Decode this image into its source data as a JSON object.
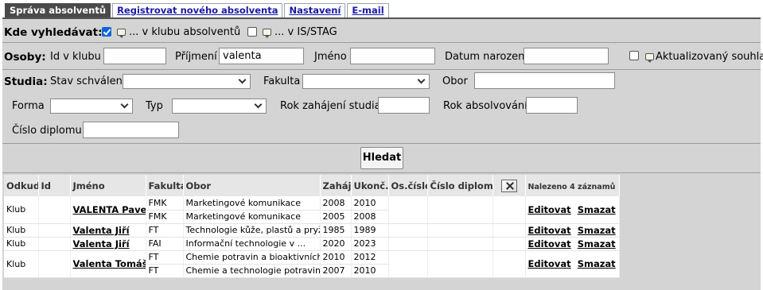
{
  "tabs": [
    {
      "label": "Správa absolventů",
      "active": true
    },
    {
      "label": "Registrovat nového absolventa",
      "active": false
    },
    {
      "label": "Nastavení",
      "active": false
    },
    {
      "label": "E-mail",
      "active": false
    }
  ],
  "search_where": {
    "label": "Kde vyhledávat:",
    "option_club": "... v klubu absolventů",
    "option_club_checked": true,
    "option_stag": "... v IS/STAG",
    "option_stag_checked": false
  },
  "persons": {
    "label": "Osoby:",
    "id_label": "Id v klubu",
    "id_value": "",
    "surname_label": "Příjmení",
    "surname_value": "valenta",
    "name_label": "Jméno",
    "name_value": "",
    "birth_label": "Datum narození",
    "birth_value": "",
    "consent_label": "Aktualizovaný souhlas",
    "consent_checked": false
  },
  "studies": {
    "label": "Studia:",
    "approval_label": "Stav schválení",
    "approval_value": "",
    "faculty_label": "Fakulta",
    "faculty_value": "",
    "field_label": "Obor",
    "field_value": "",
    "form_label": "Forma",
    "form_value": "",
    "type_label": "Typ",
    "type_value": "",
    "start_label": "Rok zahájení studia",
    "start_value": "",
    "end_label": "Rok absolvování",
    "end_value": "",
    "diploma_label": "Číslo diplomu",
    "diploma_value": ""
  },
  "search_button": "Hledat",
  "results": {
    "headers": {
      "source": "Odkud",
      "id": "Id",
      "name": "Jméno",
      "faculty": "Fakulta",
      "field": "Obor",
      "start": "Zaháj.",
      "end": "Ukonč.",
      "personal_no": "Os.číslo",
      "diploma": "Číslo diplomu",
      "found": "Nalezeno 4 záznamů"
    },
    "edit_label": "Editovat",
    "delete_label": "Smazat",
    "rows": [
      {
        "source": "Klub",
        "name": "VALENTA Pavel",
        "studies": [
          {
            "faculty": "FMK",
            "field": "Marketingové komunikace",
            "start": "2008",
            "end": "2010"
          },
          {
            "faculty": "FMK",
            "field": "Marketingové komunikace",
            "start": "2005",
            "end": "2008"
          }
        ]
      },
      {
        "source": "Klub",
        "name": "Valenta Jiří",
        "studies": [
          {
            "faculty": "FT",
            "field": "Technologie kůže, plastů a pryže",
            "start": "1985",
            "end": "1989"
          }
        ]
      },
      {
        "source": "Klub",
        "name": "Valenta Jiří",
        "studies": [
          {
            "faculty": "FAI",
            "field": "Informační technologie v ...",
            "start": "2020",
            "end": "2023"
          }
        ]
      },
      {
        "source": "Klub",
        "name": "Valenta Tomáš",
        "studies": [
          {
            "faculty": "FT",
            "field": "Chemie potravin a bioaktivních ...",
            "start": "2010",
            "end": "2012"
          },
          {
            "faculty": "FT",
            "field": "Chemie a technologie potravin",
            "start": "2007",
            "end": "2010"
          }
        ]
      }
    ]
  }
}
